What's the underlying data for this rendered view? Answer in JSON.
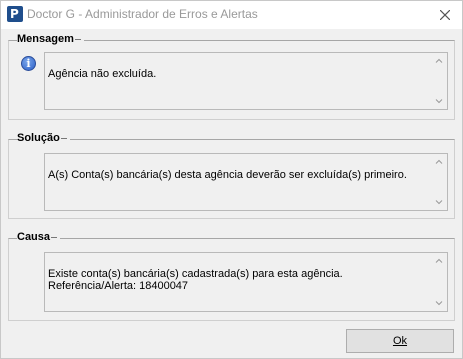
{
  "window": {
    "title": "Doctor G - Administrador de Erros e Alertas",
    "app_icon_letter": "P",
    "close_icon": "close-icon"
  },
  "sections": {
    "mensagem": {
      "title": "Mensagem",
      "icon": "info-icon",
      "icon_glyph": "i",
      "text": "Agência não excluída."
    },
    "solucao": {
      "title": "Solução",
      "text": "A(s) Conta(s) bancária(s) desta agência deverão ser excluída(s) primeiro."
    },
    "causa": {
      "title": "Causa",
      "text": "Existe conta(s) bancária(s) cadastrada(s) para esta agência.\nReferência/Alerta: 18400047"
    }
  },
  "buttons": {
    "ok_label": "Ok"
  }
}
